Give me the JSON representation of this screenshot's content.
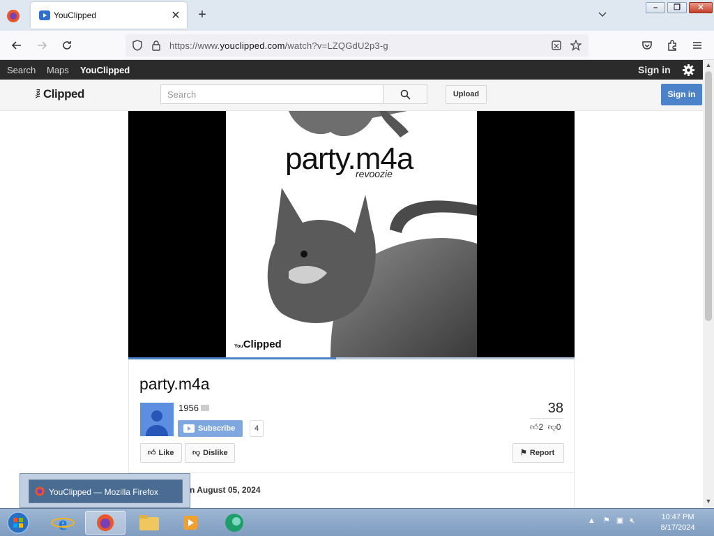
{
  "browser": {
    "tab_title": "YouClipped",
    "url_prefix": "https://www.",
    "url_domain": "youclipped.com",
    "url_path": "/watch?v=LZQGdU2p3-g"
  },
  "sitebar": {
    "links": [
      "Search",
      "Maps",
      "YouClipped"
    ],
    "signin": "Sign in"
  },
  "masthead": {
    "logo": "Clipped",
    "logo_small": "You",
    "search_placeholder": "Search",
    "upload": "Upload",
    "signin": "Sign in"
  },
  "player": {
    "art_title": "party.m4a",
    "art_subtitle": "revoozie",
    "art_logo": "Clipped",
    "art_logo_small": "You",
    "progress": 0.465
  },
  "video": {
    "title": "party.m4a",
    "channel": "1956",
    "subscribe": "Subscribe",
    "subscribers": "4",
    "views": "38",
    "likes": "2",
    "dislikes": "0",
    "like": "Like",
    "dislike": "Dislike",
    "report": "Report",
    "published": "n August 05, 2024"
  },
  "taskbar": {
    "thumb_title": "YouClipped — Mozilla Firefox",
    "time": "10:47 PM",
    "date": "8/17/2024"
  }
}
